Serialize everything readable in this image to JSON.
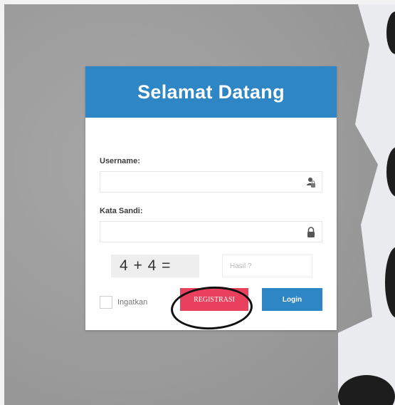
{
  "login": {
    "title": "Selamat Datang",
    "username_label": "Username:",
    "username_value": "",
    "password_label": "Kata Sandi:",
    "password_value": "",
    "captcha_question": "4 + 4 =",
    "captcha_answer_placeholder": "Hasil ?",
    "remember_label": "Ingatkan",
    "register_button": "REGISTRASI",
    "login_button": "Login"
  },
  "colors": {
    "header_blue": "#2f86c4",
    "register_red": "#e8405d",
    "login_blue": "#2f86c4"
  },
  "icons": {
    "username": "user-lock-icon",
    "password": "lock-icon"
  }
}
